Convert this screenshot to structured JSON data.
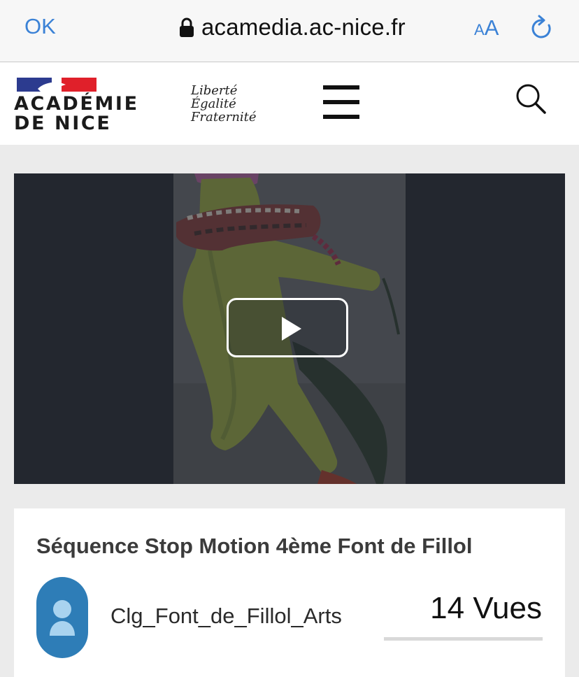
{
  "browser": {
    "done_label": "OK",
    "url": "acamedia.ac-nice.fr",
    "text_size_small": "A",
    "text_size_large": "A",
    "colors": {
      "accent": "#3b82d6"
    }
  },
  "header": {
    "logo_line1": "ACADÉMIE",
    "logo_line2": "DE NICE",
    "motto": [
      "Liberté",
      "Égalité",
      "Fraternité"
    ],
    "colors": {
      "flag_blue": "#2c3b8f",
      "flag_red": "#e0202a"
    }
  },
  "video": {
    "state": "paused",
    "colors": {
      "background": "#23272f"
    }
  },
  "media_info": {
    "title": "Séquence Stop Motion 4ème Font de Fillol",
    "author": "Clg_Font_de_Fillol_Arts",
    "views": "14 Vues",
    "colors": {
      "avatar": "#2e7db7"
    }
  }
}
